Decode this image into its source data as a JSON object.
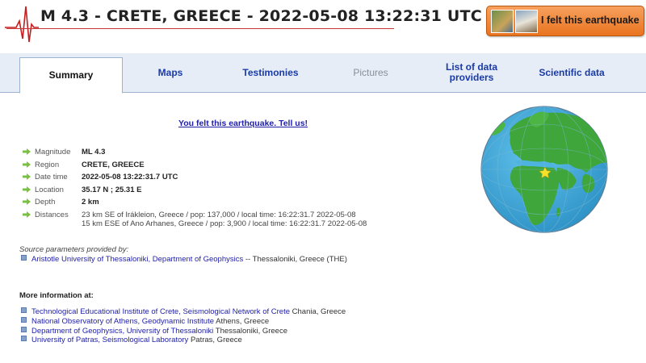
{
  "header": {
    "title": "M 4.3 - CRETE, GREECE - 2022-05-08 13:22:31 UTC",
    "felt_button": "I felt this earthquake"
  },
  "tabs": [
    {
      "label": "Summary",
      "state": "active"
    },
    {
      "label": "Maps",
      "state": "normal"
    },
    {
      "label": "Testimonies",
      "state": "normal"
    },
    {
      "label": "Pictures",
      "state": "disabled"
    },
    {
      "label": "List of data providers",
      "state": "normal"
    },
    {
      "label": "Scientific data",
      "state": "normal"
    }
  ],
  "felt_link": "You felt this earthquake. Tell us!",
  "params": {
    "magnitude": {
      "label": "Magnitude",
      "value": "ML 4.3"
    },
    "region": {
      "label": "Region",
      "value": "CRETE, GREECE"
    },
    "datetime": {
      "label": "Date time",
      "value": "2022-05-08 13:22:31.7 UTC"
    },
    "location": {
      "label": "Location",
      "value": "35.17 N ; 25.31 E"
    },
    "depth": {
      "label": "Depth",
      "value": "2 km"
    },
    "distances": {
      "label": "Distances",
      "line1": "23 km SE of Irákleion, Greece / pop: 137,000 / local time: 16:22:31.7 2022-05-08",
      "line2": "15 km ESE of Ano Arhanes, Greece / pop: 3,900 / local time: 16:22:31.7 2022-05-08"
    }
  },
  "source": {
    "label": "Source parameters provided by:",
    "link": "Aristotle University of Thessaloniki, Department of Geophysics",
    "suffix": " -- Thessaloniki, Greece (THE)"
  },
  "more_info": {
    "title": "More information at:",
    "items": [
      {
        "link": "Technological Educational Institute of Crete, Seismological Network of Crete",
        "place": " Chania, Greece"
      },
      {
        "link": "National Observatory of Athens, Geodynamic Institute",
        "place": " Athens, Greece"
      },
      {
        "link": "Department of Geophysics, University of Thessaloniki",
        "place": " Thessaloniki, Greece"
      },
      {
        "link": "University of Patras, Seismological Laboratory",
        "place": " Patras, Greece"
      }
    ]
  },
  "colors": {
    "tab_link": "#1a3aa8",
    "felt_button": "#f08a3c",
    "ocean": "#3aa6d8",
    "land": "#3ea63a",
    "epicenter_star": "#f5e12a"
  },
  "icons": {
    "seismogram": "seismogram-logo",
    "param_arrow": "green-arrow-icon",
    "globe": "world-globe"
  }
}
